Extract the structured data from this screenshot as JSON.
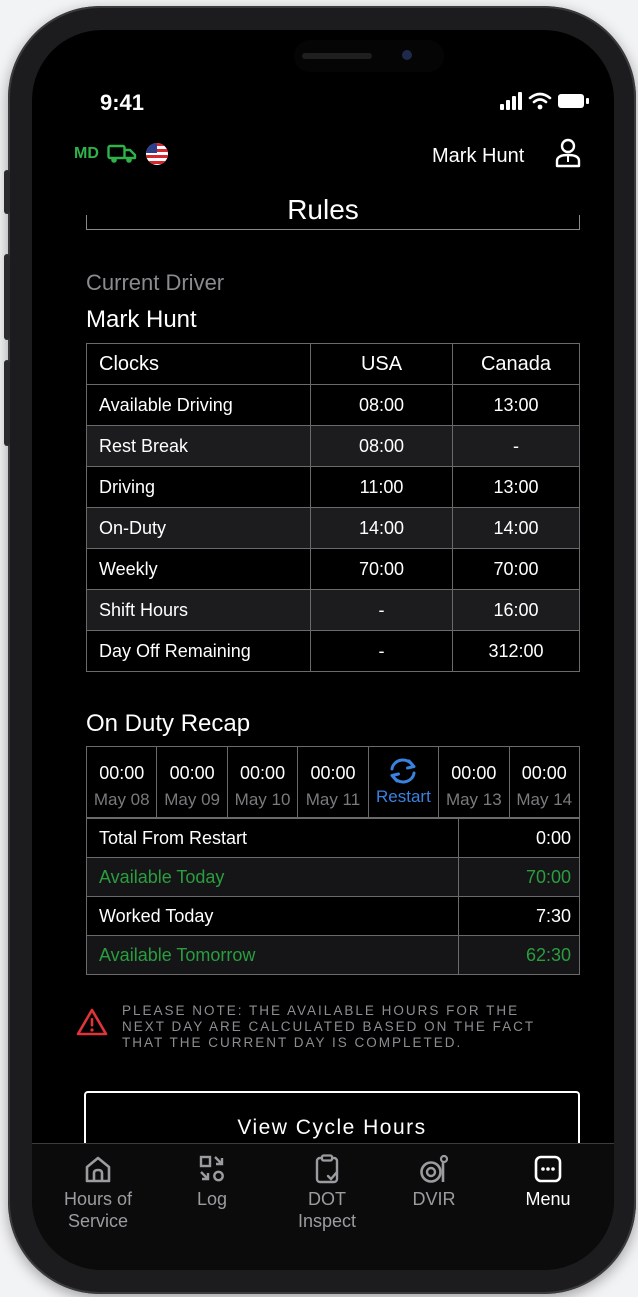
{
  "status_bar": {
    "time": "9:41"
  },
  "header": {
    "state_code": "MD",
    "driver_name": "Mark Hunt",
    "title": "Rules"
  },
  "driver_section": {
    "subtitle": "Current Driver",
    "name": "Mark Hunt"
  },
  "clocks_table": {
    "headers": [
      "Clocks",
      "USA",
      "Canada"
    ],
    "rows": [
      [
        "Available Driving",
        "08:00",
        "13:00"
      ],
      [
        "Rest Break",
        "08:00",
        "-"
      ],
      [
        "Driving",
        "11:00",
        "13:00"
      ],
      [
        "On-Duty",
        "14:00",
        "14:00"
      ],
      [
        "Weekly",
        "70:00",
        "70:00"
      ],
      [
        "Shift Hours",
        "-",
        "16:00"
      ],
      [
        "Day Off Remaining",
        "-",
        "312:00"
      ]
    ]
  },
  "recap": {
    "title": "On Duty Recap",
    "days": [
      {
        "value": "00:00",
        "date": "May 08"
      },
      {
        "value": "00:00",
        "date": "May 09"
      },
      {
        "value": "00:00",
        "date": "May 10"
      },
      {
        "value": "00:00",
        "date": "May 11"
      },
      {
        "value": "",
        "date": "Restart"
      },
      {
        "value": "00:00",
        "date": "May 13"
      },
      {
        "value": "00:00",
        "date": "May 14"
      }
    ],
    "rows": [
      {
        "label": "Total From Restart",
        "value": "0:00"
      },
      {
        "label": "Available Today",
        "value": "70:00"
      },
      {
        "label": "Worked Today",
        "value": "7:30"
      },
      {
        "label": "Available Tomorrow",
        "value": "62:30"
      }
    ]
  },
  "note": {
    "line1": "PLEASE NOTE: THE AVAILABLE HOURS FOR THE",
    "line2": "NEXT DAY ARE CALCULATED BASED ON THE FACT",
    "line3": "THAT THE CURRENT DAY IS COMPLETED."
  },
  "cycle_button": {
    "label": "View Cycle Hours"
  },
  "tabs": [
    {
      "line1": "Hours of",
      "line2": "Service"
    },
    {
      "line1": "Log",
      "line2": ""
    },
    {
      "line1": "DOT",
      "line2": "Inspect"
    },
    {
      "line1": "DVIR",
      "line2": ""
    },
    {
      "line1": "Menu",
      "line2": ""
    }
  ],
  "colors": {
    "background": "#000000",
    "green": "#2a9d3f",
    "blue": "#3a82e0",
    "warning_red": "#e0343a"
  }
}
